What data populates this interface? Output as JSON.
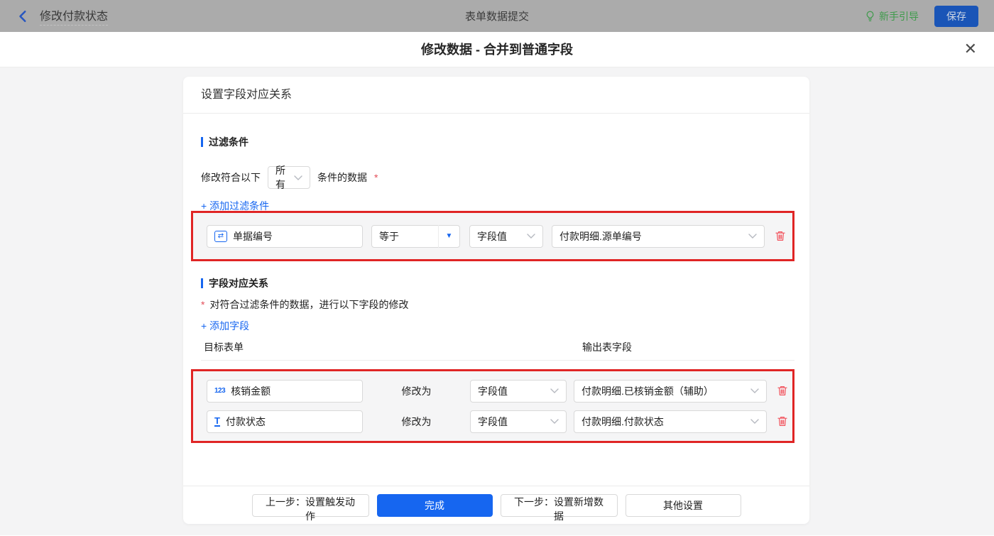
{
  "topbar": {
    "back_label": "修改付款状态",
    "center_title": "表单数据提交",
    "guide_label": "新手引导",
    "save_label": "保存"
  },
  "modal": {
    "title": "修改数据 - 合并到普通字段",
    "close_icon": "✕"
  },
  "card": {
    "header": "设置字段对应关系",
    "filter_section": {
      "title": "过滤条件",
      "match_prefix": "修改符合以下",
      "match_select": "所有",
      "match_suffix": "条件的数据",
      "required_mark": "*",
      "add_link": "+ 添加过滤条件",
      "condition": {
        "field_icon": "⇄",
        "field": "单据编号",
        "operator": "等于",
        "value_type": "字段值",
        "value": "付款明细.源单编号"
      }
    },
    "mapping_section": {
      "title": "字段对应关系",
      "required_mark": "*",
      "description": "对符合过滤条件的数据，进行以下字段的修改",
      "add_link": "+ 添加字段",
      "col_target": "目标表单",
      "col_output": "输出表字段",
      "rows": [
        {
          "icon": "123",
          "field": "核销金额",
          "modify_label": "修改为",
          "value_type": "字段值",
          "value": "付款明细.已核销金额（辅助）"
        },
        {
          "icon": "T",
          "field": "付款状态",
          "modify_label": "修改为",
          "value_type": "字段值",
          "value": "付款明细.付款状态"
        }
      ]
    },
    "footer": {
      "prev_label": "上一步：设置触发动作",
      "done_label": "完成",
      "next_label": "下一步：设置新增数据",
      "other_label": "其他设置"
    }
  },
  "icons": {
    "caret_down_filled": "▼"
  },
  "colors": {
    "accent_blue": "#1666f0",
    "highlight_red": "#e02525",
    "trash_red": "#f2545e",
    "guide_green": "#3f9b4c",
    "page_bg": "#f4f4f5",
    "row_bg": "#f5f5f6"
  }
}
